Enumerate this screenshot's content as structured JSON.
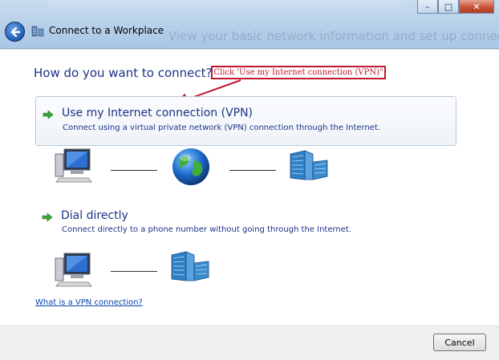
{
  "window": {
    "title": "Connect to a Workplace",
    "minimize_label": "–",
    "maximize_label": "□",
    "close_label": "✕"
  },
  "background_text": "View your basic network information and set up connections",
  "main": {
    "heading": "How do you want to connect?",
    "annotation": "Click 'Use my Internet connection (VPN)\"",
    "options": [
      {
        "title": "Use my Internet connection (VPN)",
        "description": "Connect using a virtual private network (VPN) connection through the Internet."
      },
      {
        "title": "Dial directly",
        "description": "Connect directly to a phone number without going through the Internet."
      }
    ],
    "help_link": "What is a VPN connection?"
  },
  "footer": {
    "cancel_label": "Cancel"
  },
  "colors": {
    "text_blue": "#1e3287",
    "link_blue": "#0645ad",
    "annotation_red": "#c0182f",
    "arrow_green": "#3aa63a"
  }
}
